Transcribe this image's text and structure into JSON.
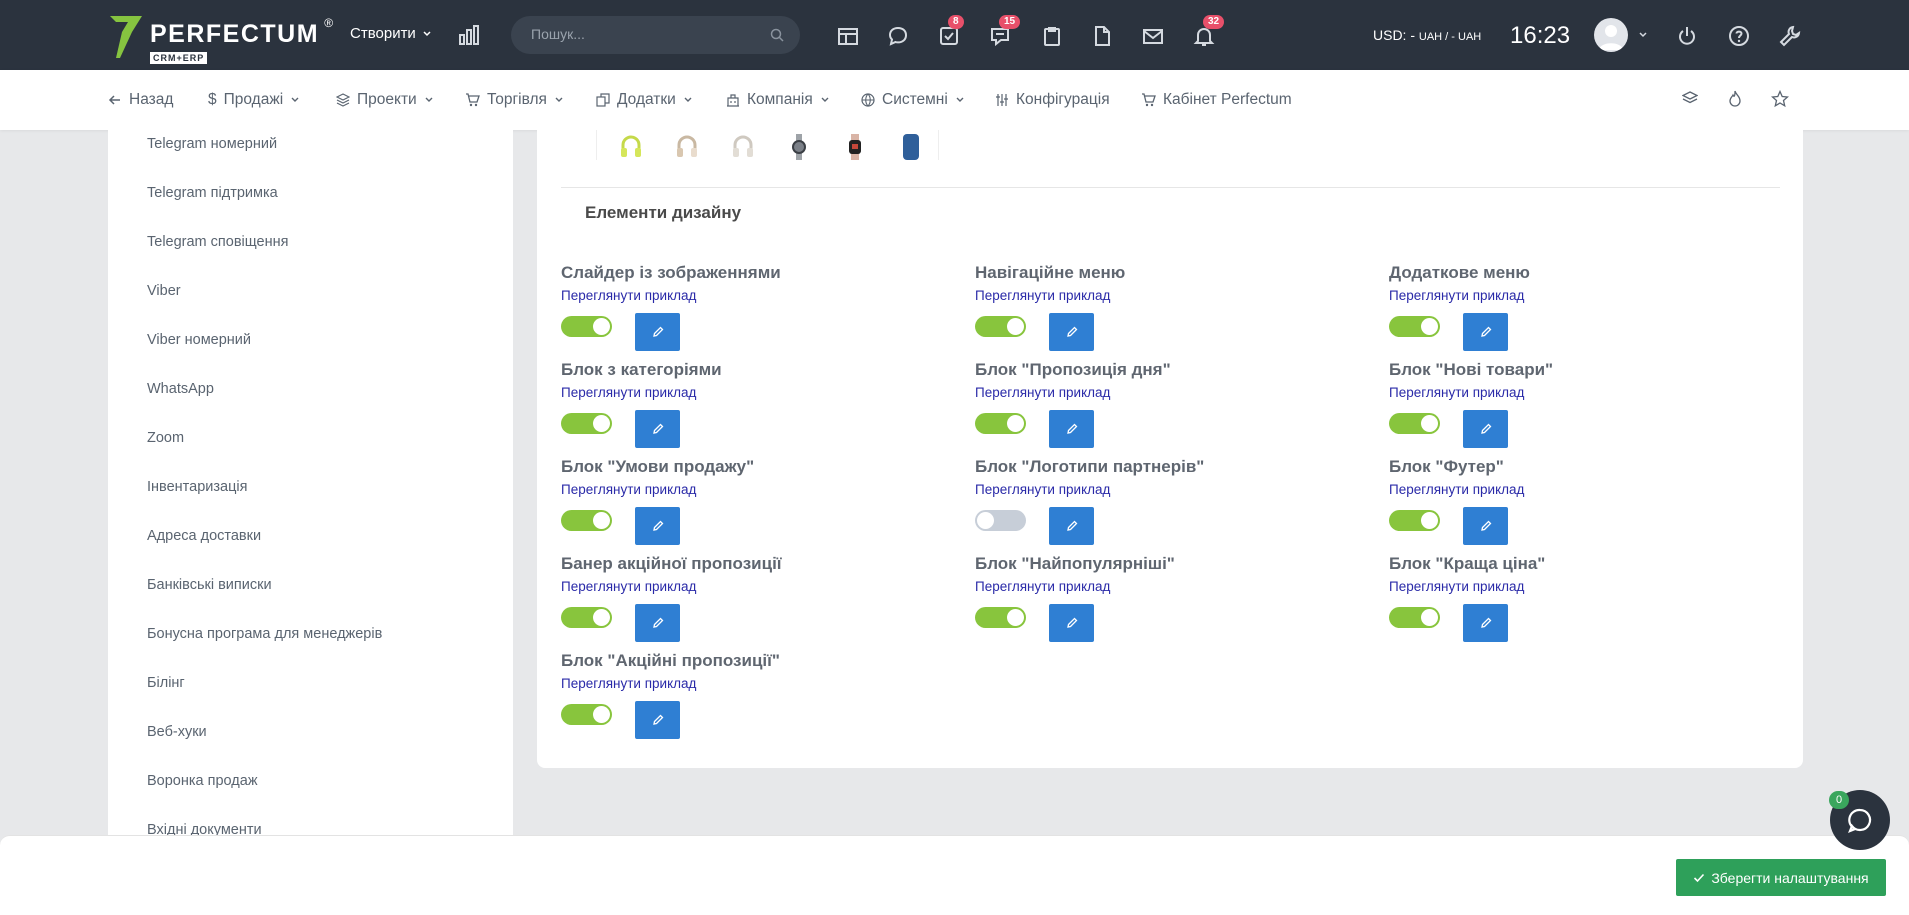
{
  "brand": {
    "name": "PERFECTUM",
    "reg": "®",
    "sub": "CRM+ERP"
  },
  "topbar": {
    "create_label": "Створити",
    "search_placeholder": "Пошук...",
    "badges": {
      "tasks": "8",
      "chat": "15",
      "notifications": "32"
    },
    "currency_label": "USD: - ",
    "currency_sub": "UAH / - UAH",
    "clock": "16:23"
  },
  "nav": {
    "items": [
      {
        "label": "Назад",
        "icon": "arrow-left-icon"
      },
      {
        "label": "Продажі",
        "icon": "dollar-icon"
      },
      {
        "label": "Проекти",
        "icon": "layers-icon"
      },
      {
        "label": "Торгівля",
        "icon": "cart-icon"
      },
      {
        "label": "Додатки",
        "icon": "copy-icon"
      },
      {
        "label": "Компанія",
        "icon": "building-icon"
      },
      {
        "label": "Системні",
        "icon": "globe-icon"
      },
      {
        "label": "Конфігурація",
        "icon": "sliders-icon"
      },
      {
        "label": "Кабінет Perfectum",
        "icon": "cart-icon"
      }
    ]
  },
  "sidebar": {
    "items": [
      "Telegram номерний",
      "Telegram підтримка",
      "Telegram сповіщення",
      "Viber",
      "Viber номерний",
      "WhatsApp",
      "Zoom",
      "Інвентаризація",
      "Адреса доставки",
      "Банківські виписки",
      "Бонусна програма для менеджерів",
      "Білінг",
      "Веб-хуки",
      "Воронка продаж",
      "Вхідні документи"
    ]
  },
  "main": {
    "section_title": "Елементи дизайну",
    "link_label": "Переглянути приклад",
    "features": [
      {
        "title": "Слайдер із зображеннями",
        "enabled": true
      },
      {
        "title": "Навігаційне меню",
        "enabled": true
      },
      {
        "title": "Додаткове меню",
        "enabled": true
      },
      {
        "title": "Блок з категоріями",
        "enabled": true
      },
      {
        "title": "Блок \"Пропозиція дня\"",
        "enabled": true
      },
      {
        "title": "Блок \"Нові товари\"",
        "enabled": true
      },
      {
        "title": "Блок \"Умови продажу\"",
        "enabled": true
      },
      {
        "title": "Блок \"Логотипи партнерів\"",
        "enabled": false
      },
      {
        "title": "Блок \"Футер\"",
        "enabled": true
      },
      {
        "title": "Банер акційної пропозиції",
        "enabled": true
      },
      {
        "title": "Блок \"Найпопулярніші\"",
        "enabled": true
      },
      {
        "title": "Блок \"Краща ціна\"",
        "enabled": true
      },
      {
        "title": "Блок \"Акційні пропозиції\"",
        "enabled": true
      }
    ]
  },
  "footer": {
    "save_label": "Зберегти налаштування"
  },
  "chat": {
    "badge": "0"
  },
  "colors": {
    "topbar": "#2b333e",
    "toggle_on": "#88c53d",
    "edit_button": "#2f7fd3",
    "save_button": "#2ea05a",
    "link": "#2a2aa8"
  }
}
